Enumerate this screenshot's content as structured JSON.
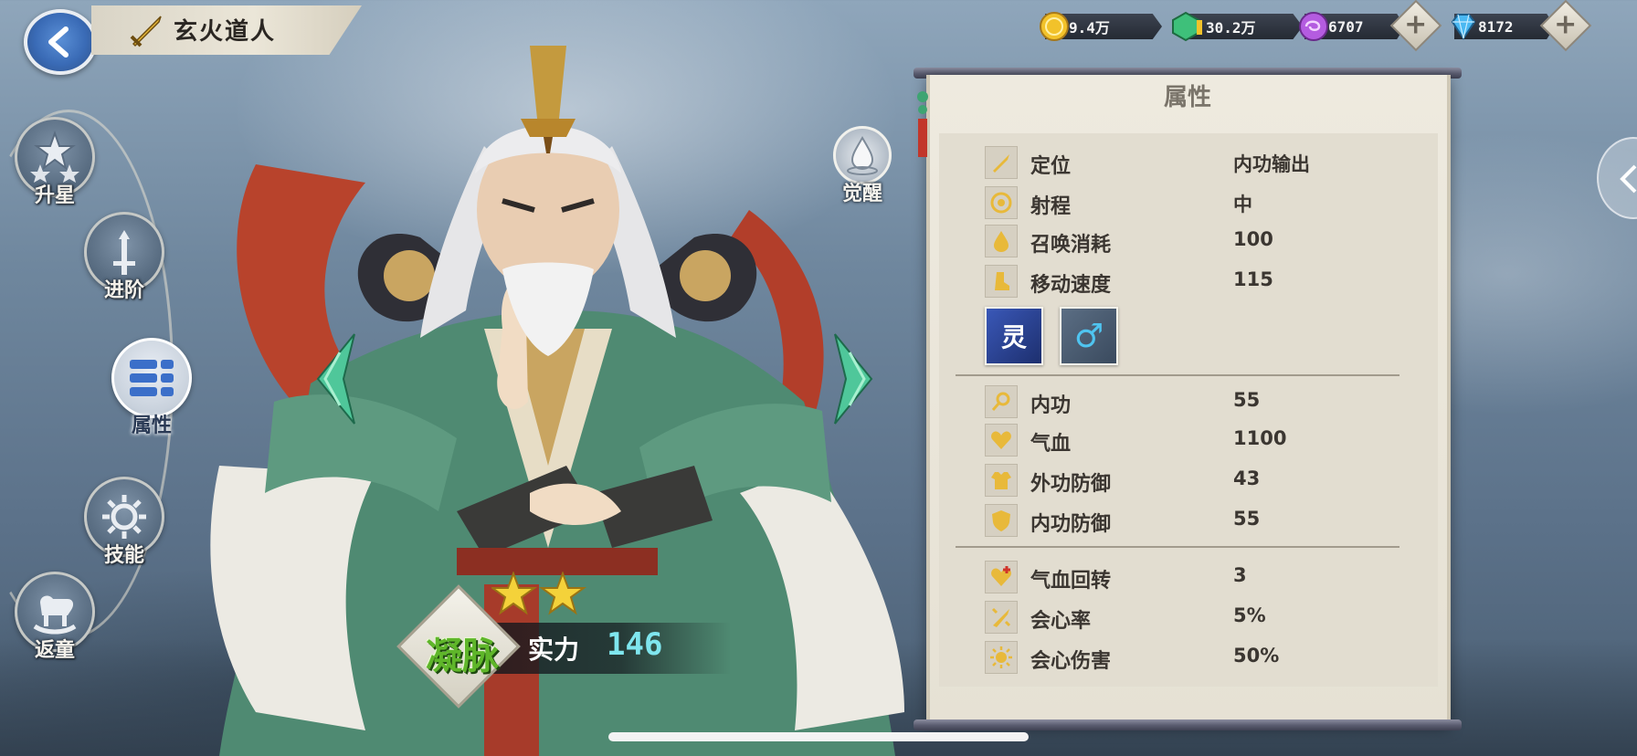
{
  "header": {
    "hero_name": "玄火道人"
  },
  "currency": {
    "gold": "9.4万",
    "jade": "30.2万",
    "spirit": "6707",
    "diamond": "8172",
    "plus": "+"
  },
  "nav": {
    "items": [
      {
        "label": "升星"
      },
      {
        "label": "进阶"
      },
      {
        "label": "属性"
      },
      {
        "label": "技能"
      },
      {
        "label": "返童"
      }
    ]
  },
  "awaken": {
    "label": "觉醒"
  },
  "hero": {
    "stars": 2,
    "rank_label": "凝脉",
    "power_label": "实力",
    "power_value": "146"
  },
  "panel": {
    "title": "属性",
    "basic": [
      {
        "icon": "sword-role-icon",
        "name": "定位",
        "value": "内功输出"
      },
      {
        "icon": "target-icon",
        "name": "射程",
        "value": "中"
      },
      {
        "icon": "drop-icon",
        "name": "召唤消耗",
        "value": "100"
      },
      {
        "icon": "boot-icon",
        "name": "移动速度",
        "value": "115"
      }
    ],
    "traits": [
      {
        "icon": "spirit-emblem-icon",
        "text": "灵"
      },
      {
        "icon": "male-symbol-icon",
        "text": "♂"
      }
    ],
    "combat": [
      {
        "icon": "inner-power-icon",
        "name": "内功",
        "value": "55"
      },
      {
        "icon": "heart-icon",
        "name": "气血",
        "value": "1100"
      },
      {
        "icon": "armor-icon",
        "name": "外功防御",
        "value": "43"
      },
      {
        "icon": "shield-icon",
        "name": "内功防御",
        "value": "55"
      }
    ],
    "advanced": [
      {
        "icon": "heal-icon",
        "name": "气血回转",
        "value": "3"
      },
      {
        "icon": "crit-icon",
        "name": "会心率",
        "value": "5%"
      },
      {
        "icon": "sun-icon",
        "name": "会心伤害",
        "value": "50%"
      }
    ]
  }
}
